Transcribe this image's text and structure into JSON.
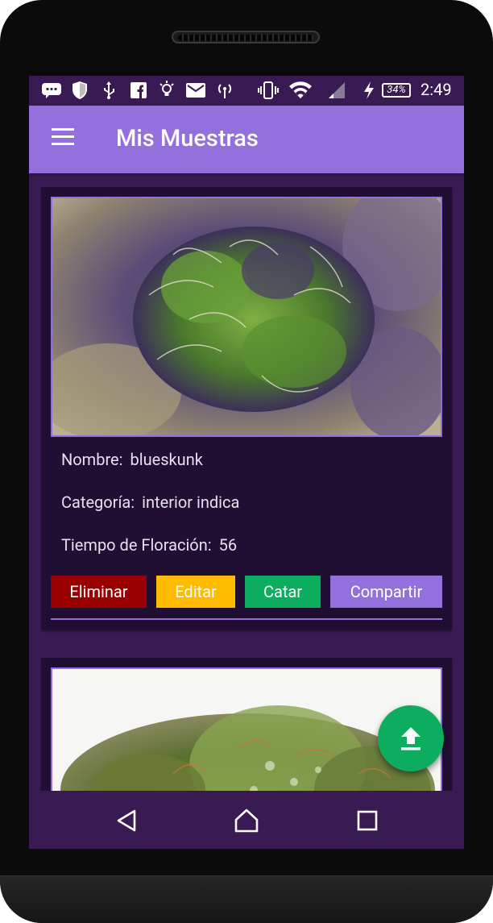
{
  "status_bar": {
    "battery_level": "34%",
    "time": "2:49",
    "icons": [
      "message-icon",
      "shield-icon",
      "usb-icon",
      "facebook-icon",
      "bulb-icon",
      "mail-icon",
      "hotspot-icon",
      "vibrate-icon",
      "wifi-icon",
      "signal-icon",
      "charging-icon",
      "battery-icon"
    ]
  },
  "app_bar": {
    "title": "Mis Muestras",
    "menu_icon": "hamburger-menu-icon"
  },
  "samples": [
    {
      "name_label": "Nombre:",
      "name_value": "blueskunk",
      "category_label": "Categoría:",
      "category_value": "interior indica",
      "flowering_label": "Tiempo de Floración:",
      "flowering_value": "56",
      "buttons": {
        "delete": "Eliminar",
        "edit": "Editar",
        "taste": "Catar",
        "share": "Compartir"
      }
    }
  ],
  "fab": {
    "icon": "upload-icon"
  },
  "nav_bar": {
    "icons": [
      "back-icon",
      "home-icon",
      "recents-icon"
    ]
  },
  "colors": {
    "primary": "#9370db",
    "background": "#3a1a52",
    "card": "#200e33",
    "delete": "#990000",
    "edit": "#ffbb00",
    "taste": "#0dad60",
    "share": "#9370db",
    "fab": "#0dad60"
  }
}
